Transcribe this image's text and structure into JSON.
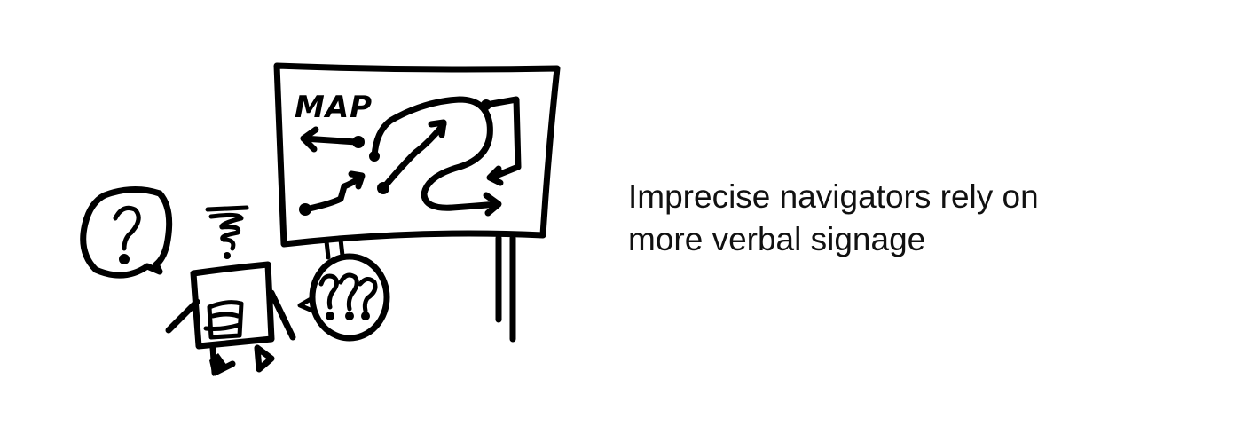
{
  "illustration": {
    "map_label": "MAP",
    "stroke_color": "#000000"
  },
  "caption": {
    "line1": "Imprecise navigators rely on",
    "line2": "more verbal signage"
  },
  "colors": {
    "background": "#ffffff",
    "text": "#111111"
  }
}
